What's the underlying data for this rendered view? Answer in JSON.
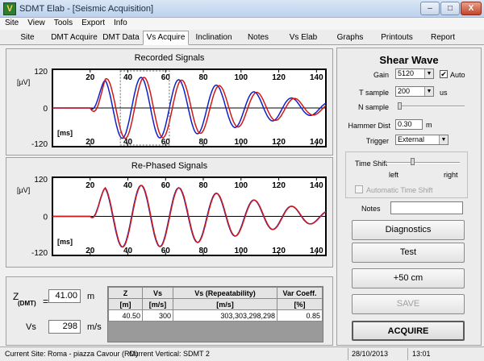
{
  "window": {
    "title": "SDMT Elab - [Seismic Acquisition]",
    "min_glyph": "‒",
    "max_glyph": "□",
    "close_glyph": "X"
  },
  "menu": [
    "Site",
    "View",
    "Tools",
    "Export",
    "Info"
  ],
  "tabs": [
    "Site",
    "DMT Acquire",
    "DMT Data",
    "Vs Acquire",
    "Inclination",
    "Notes",
    "Vs Elab",
    "Graphs",
    "Printouts",
    "Report"
  ],
  "active_tab": "Vs Acquire",
  "recorded": {
    "title": "Recorded Signals",
    "unit_y": "[µV]",
    "unit_x": "[ms]",
    "y_ticks": [
      "120",
      "0",
      "-120"
    ],
    "x_ticks": [
      "20",
      "40",
      "60",
      "80",
      "100",
      "120",
      "140"
    ]
  },
  "rephased": {
    "title": "Re-Phased Signals",
    "unit_y": "[µV]",
    "unit_x": "[ms]",
    "y_ticks": [
      "120",
      "0",
      "-120"
    ],
    "x_ticks": [
      "20",
      "40",
      "60",
      "80",
      "100",
      "120",
      "140"
    ]
  },
  "chart_colors": {
    "blue": "#1020c8",
    "red": "#d01818"
  },
  "shear": {
    "title": "Shear Wave",
    "gain_label": "Gain",
    "gain_value": "5120",
    "auto_label": "Auto",
    "auto_checked": "✔",
    "tsample_label": "T sample",
    "tsample_value": "200",
    "tsample_unit": "us",
    "nsample_label": "N sample",
    "hammer_label": "Hammer Dist",
    "hammer_value": "0.30",
    "hammer_unit": "m",
    "trigger_label": "Trigger",
    "trigger_value": "External",
    "timeshift_label": "Time Shift",
    "left_label": "left",
    "right_label": "right",
    "auto_shift_label": "Automatic Time Shift",
    "notes_label": "Notes"
  },
  "buttons": {
    "diagnostics": "Diagnostics",
    "test": "Test",
    "plus50": "+50 cm",
    "save": "SAVE",
    "acquire": "ACQUIRE"
  },
  "results": {
    "z_label": "Z",
    "z_sub": "(DMT)",
    "z_value": "41.00",
    "z_unit": "m",
    "vs_label": "Vs",
    "vs_value": "298",
    "vs_unit": "m/s",
    "headers": [
      "Z",
      "Vs",
      "Vs (Repeatability)",
      "Var Coeff."
    ],
    "units": [
      "[m]",
      "[m/s]",
      "[m/s]",
      "[%]"
    ],
    "row": [
      "40.50",
      "300",
      "303,303,298,298",
      "0.85"
    ]
  },
  "status": {
    "site": "Current Site: Roma - piazza Cavour (RM)",
    "vertical": "Current Vertical: SDMT 2",
    "date": "28/10/2013",
    "time": "13:01"
  }
}
